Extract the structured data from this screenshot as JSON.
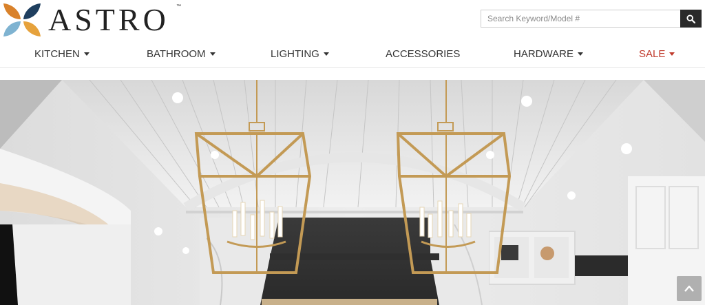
{
  "brand": {
    "name": "ASTRO",
    "trademark": "™"
  },
  "search": {
    "placeholder": "Search Keyword/Model #",
    "button_icon": "search-icon"
  },
  "nav": {
    "items": [
      {
        "label": "KITCHEN",
        "dropdown": true
      },
      {
        "label": "BATHROOM",
        "dropdown": true
      },
      {
        "label": "LIGHTING",
        "dropdown": true
      },
      {
        "label": "ACCESSORIES",
        "dropdown": false
      },
      {
        "label": "HARDWARE",
        "dropdown": true
      },
      {
        "label": "SALE",
        "dropdown": true,
        "color": "#c0392b"
      }
    ]
  },
  "hero": {
    "image": "kitchen-pendant-lanterns-photo"
  },
  "scroll_top": {
    "icon": "chevron-up-icon"
  }
}
